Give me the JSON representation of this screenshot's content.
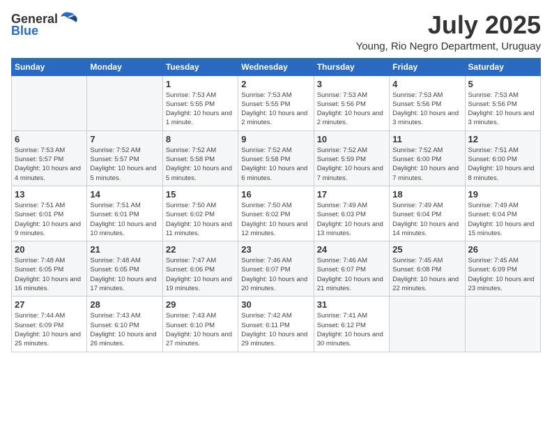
{
  "header": {
    "logo_general": "General",
    "logo_blue": "Blue",
    "month_title": "July 2025",
    "location": "Young, Rio Negro Department, Uruguay"
  },
  "weekdays": [
    "Sunday",
    "Monday",
    "Tuesday",
    "Wednesday",
    "Thursday",
    "Friday",
    "Saturday"
  ],
  "weeks": [
    [
      {
        "day": "",
        "info": ""
      },
      {
        "day": "",
        "info": ""
      },
      {
        "day": "1",
        "info": "Sunrise: 7:53 AM\nSunset: 5:55 PM\nDaylight: 10 hours and 1 minute."
      },
      {
        "day": "2",
        "info": "Sunrise: 7:53 AM\nSunset: 5:55 PM\nDaylight: 10 hours and 2 minutes."
      },
      {
        "day": "3",
        "info": "Sunrise: 7:53 AM\nSunset: 5:56 PM\nDaylight: 10 hours and 2 minutes."
      },
      {
        "day": "4",
        "info": "Sunrise: 7:53 AM\nSunset: 5:56 PM\nDaylight: 10 hours and 3 minutes."
      },
      {
        "day": "5",
        "info": "Sunrise: 7:53 AM\nSunset: 5:56 PM\nDaylight: 10 hours and 3 minutes."
      }
    ],
    [
      {
        "day": "6",
        "info": "Sunrise: 7:53 AM\nSunset: 5:57 PM\nDaylight: 10 hours and 4 minutes."
      },
      {
        "day": "7",
        "info": "Sunrise: 7:52 AM\nSunset: 5:57 PM\nDaylight: 10 hours and 5 minutes."
      },
      {
        "day": "8",
        "info": "Sunrise: 7:52 AM\nSunset: 5:58 PM\nDaylight: 10 hours and 5 minutes."
      },
      {
        "day": "9",
        "info": "Sunrise: 7:52 AM\nSunset: 5:58 PM\nDaylight: 10 hours and 6 minutes."
      },
      {
        "day": "10",
        "info": "Sunrise: 7:52 AM\nSunset: 5:59 PM\nDaylight: 10 hours and 7 minutes."
      },
      {
        "day": "11",
        "info": "Sunrise: 7:52 AM\nSunset: 6:00 PM\nDaylight: 10 hours and 7 minutes."
      },
      {
        "day": "12",
        "info": "Sunrise: 7:51 AM\nSunset: 6:00 PM\nDaylight: 10 hours and 8 minutes."
      }
    ],
    [
      {
        "day": "13",
        "info": "Sunrise: 7:51 AM\nSunset: 6:01 PM\nDaylight: 10 hours and 9 minutes."
      },
      {
        "day": "14",
        "info": "Sunrise: 7:51 AM\nSunset: 6:01 PM\nDaylight: 10 hours and 10 minutes."
      },
      {
        "day": "15",
        "info": "Sunrise: 7:50 AM\nSunset: 6:02 PM\nDaylight: 10 hours and 11 minutes."
      },
      {
        "day": "16",
        "info": "Sunrise: 7:50 AM\nSunset: 6:02 PM\nDaylight: 10 hours and 12 minutes."
      },
      {
        "day": "17",
        "info": "Sunrise: 7:49 AM\nSunset: 6:03 PM\nDaylight: 10 hours and 13 minutes."
      },
      {
        "day": "18",
        "info": "Sunrise: 7:49 AM\nSunset: 6:04 PM\nDaylight: 10 hours and 14 minutes."
      },
      {
        "day": "19",
        "info": "Sunrise: 7:49 AM\nSunset: 6:04 PM\nDaylight: 10 hours and 15 minutes."
      }
    ],
    [
      {
        "day": "20",
        "info": "Sunrise: 7:48 AM\nSunset: 6:05 PM\nDaylight: 10 hours and 16 minutes."
      },
      {
        "day": "21",
        "info": "Sunrise: 7:48 AM\nSunset: 6:05 PM\nDaylight: 10 hours and 17 minutes."
      },
      {
        "day": "22",
        "info": "Sunrise: 7:47 AM\nSunset: 6:06 PM\nDaylight: 10 hours and 19 minutes."
      },
      {
        "day": "23",
        "info": "Sunrise: 7:46 AM\nSunset: 6:07 PM\nDaylight: 10 hours and 20 minutes."
      },
      {
        "day": "24",
        "info": "Sunrise: 7:46 AM\nSunset: 6:07 PM\nDaylight: 10 hours and 21 minutes."
      },
      {
        "day": "25",
        "info": "Sunrise: 7:45 AM\nSunset: 6:08 PM\nDaylight: 10 hours and 22 minutes."
      },
      {
        "day": "26",
        "info": "Sunrise: 7:45 AM\nSunset: 6:09 PM\nDaylight: 10 hours and 23 minutes."
      }
    ],
    [
      {
        "day": "27",
        "info": "Sunrise: 7:44 AM\nSunset: 6:09 PM\nDaylight: 10 hours and 25 minutes."
      },
      {
        "day": "28",
        "info": "Sunrise: 7:43 AM\nSunset: 6:10 PM\nDaylight: 10 hours and 26 minutes."
      },
      {
        "day": "29",
        "info": "Sunrise: 7:43 AM\nSunset: 6:10 PM\nDaylight: 10 hours and 27 minutes."
      },
      {
        "day": "30",
        "info": "Sunrise: 7:42 AM\nSunset: 6:11 PM\nDaylight: 10 hours and 29 minutes."
      },
      {
        "day": "31",
        "info": "Sunrise: 7:41 AM\nSunset: 6:12 PM\nDaylight: 10 hours and 30 minutes."
      },
      {
        "day": "",
        "info": ""
      },
      {
        "day": "",
        "info": ""
      }
    ]
  ]
}
